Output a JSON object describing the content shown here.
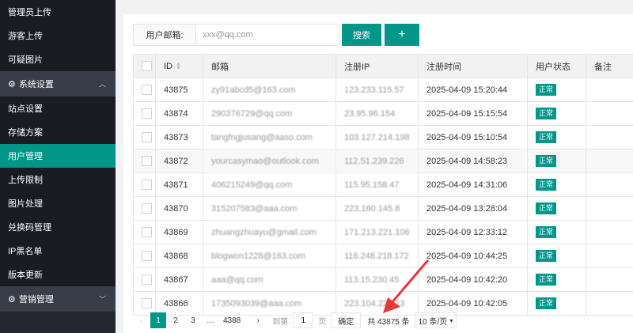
{
  "sidebar": {
    "items": [
      {
        "label": "管理员上传",
        "type": "sub"
      },
      {
        "label": "游客上传",
        "type": "sub"
      },
      {
        "label": "可疑图片",
        "type": "sub"
      },
      {
        "label": "系统设置",
        "type": "group"
      },
      {
        "label": "站点设置",
        "type": "sub"
      },
      {
        "label": "存储方案",
        "type": "sub"
      },
      {
        "label": "用户管理",
        "type": "active"
      },
      {
        "label": "上传限制",
        "type": "sub"
      },
      {
        "label": "图片处理",
        "type": "sub"
      },
      {
        "label": "兑换码管理",
        "type": "sub"
      },
      {
        "label": "IP黑名单",
        "type": "sub"
      },
      {
        "label": "版本更新",
        "type": "sub"
      },
      {
        "label": "营销管理",
        "type": "group"
      }
    ]
  },
  "search": {
    "label": "用户邮箱:",
    "placeholder": "xxx@qq.com",
    "button": "搜索",
    "add": "+"
  },
  "table": {
    "headers": [
      "ID",
      "邮箱",
      "注册IP",
      "注册时间",
      "用户状态",
      "备注"
    ],
    "rows": [
      {
        "id": "43875",
        "email": "zy91abcd5@163.com",
        "ip": "123.233.115.57",
        "time": "2025-04-09 15:20:44",
        "status": "正常"
      },
      {
        "id": "43874",
        "email": "290376729@qq.com",
        "ip": "23.95.96.154",
        "time": "2025-04-09 15:15:54",
        "status": "正常"
      },
      {
        "id": "43873",
        "email": "tangfngjusang@aaso.com",
        "ip": "103.127.214.198",
        "time": "2025-04-09 15:10:54",
        "status": "正常"
      },
      {
        "id": "43872",
        "email": "yourcasymao@outlook.com",
        "ip": "112.51.239.226",
        "time": "2025-04-09 14:58:23",
        "status": "正常"
      },
      {
        "id": "43871",
        "email": "406215249@qq.com",
        "ip": "115.95.158.47",
        "time": "2025-04-09 14:31:06",
        "status": "正常"
      },
      {
        "id": "43870",
        "email": "315207583@aaa.com",
        "ip": "223.160.145.8",
        "time": "2025-04-09 13:28:04",
        "status": "正常"
      },
      {
        "id": "43869",
        "email": "zhuangzhuayu@gmail.com",
        "ip": "171.213.221.106",
        "time": "2025-04-09 12:33:12",
        "status": "正常"
      },
      {
        "id": "43868",
        "email": "blogwon1228@163.com",
        "ip": "116.248.218.172",
        "time": "2025-04-09 10:44:25",
        "status": "正常"
      },
      {
        "id": "43867",
        "email": "aaa@qq.com",
        "ip": "113.15.230.45",
        "time": "2025-04-09 10:42:20",
        "status": "正常"
      },
      {
        "id": "43866",
        "email": "1735093039@aaa.com",
        "ip": "223.104.228.13",
        "time": "2025-04-09 10:42:05",
        "status": "正常"
      }
    ]
  },
  "pager": {
    "prev": "‹",
    "pages": [
      "1",
      "2",
      "3",
      "…",
      "4388"
    ],
    "next": "›",
    "goto_prefix": "到第",
    "goto_value": "1",
    "goto_suffix": "页",
    "confirm": "确定",
    "total": "共 43875 条",
    "per_page": "10 条/页"
  },
  "colors": {
    "accent": "#009688",
    "sidebar_bg": "#23262e",
    "arrow": "#e53935"
  }
}
